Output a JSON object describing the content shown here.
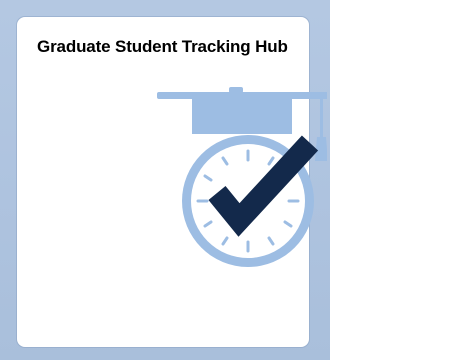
{
  "tile": {
    "title": "Graduate Student Tracking Hub",
    "icon": "graduation-cap-clock-checkmark-icon"
  },
  "colors": {
    "frame_background": "#b0c5e0",
    "tile_background": "#ffffff",
    "icon_light_blue": "#9dbde3",
    "icon_dark_navy": "#13294b",
    "title_text": "#000000"
  }
}
